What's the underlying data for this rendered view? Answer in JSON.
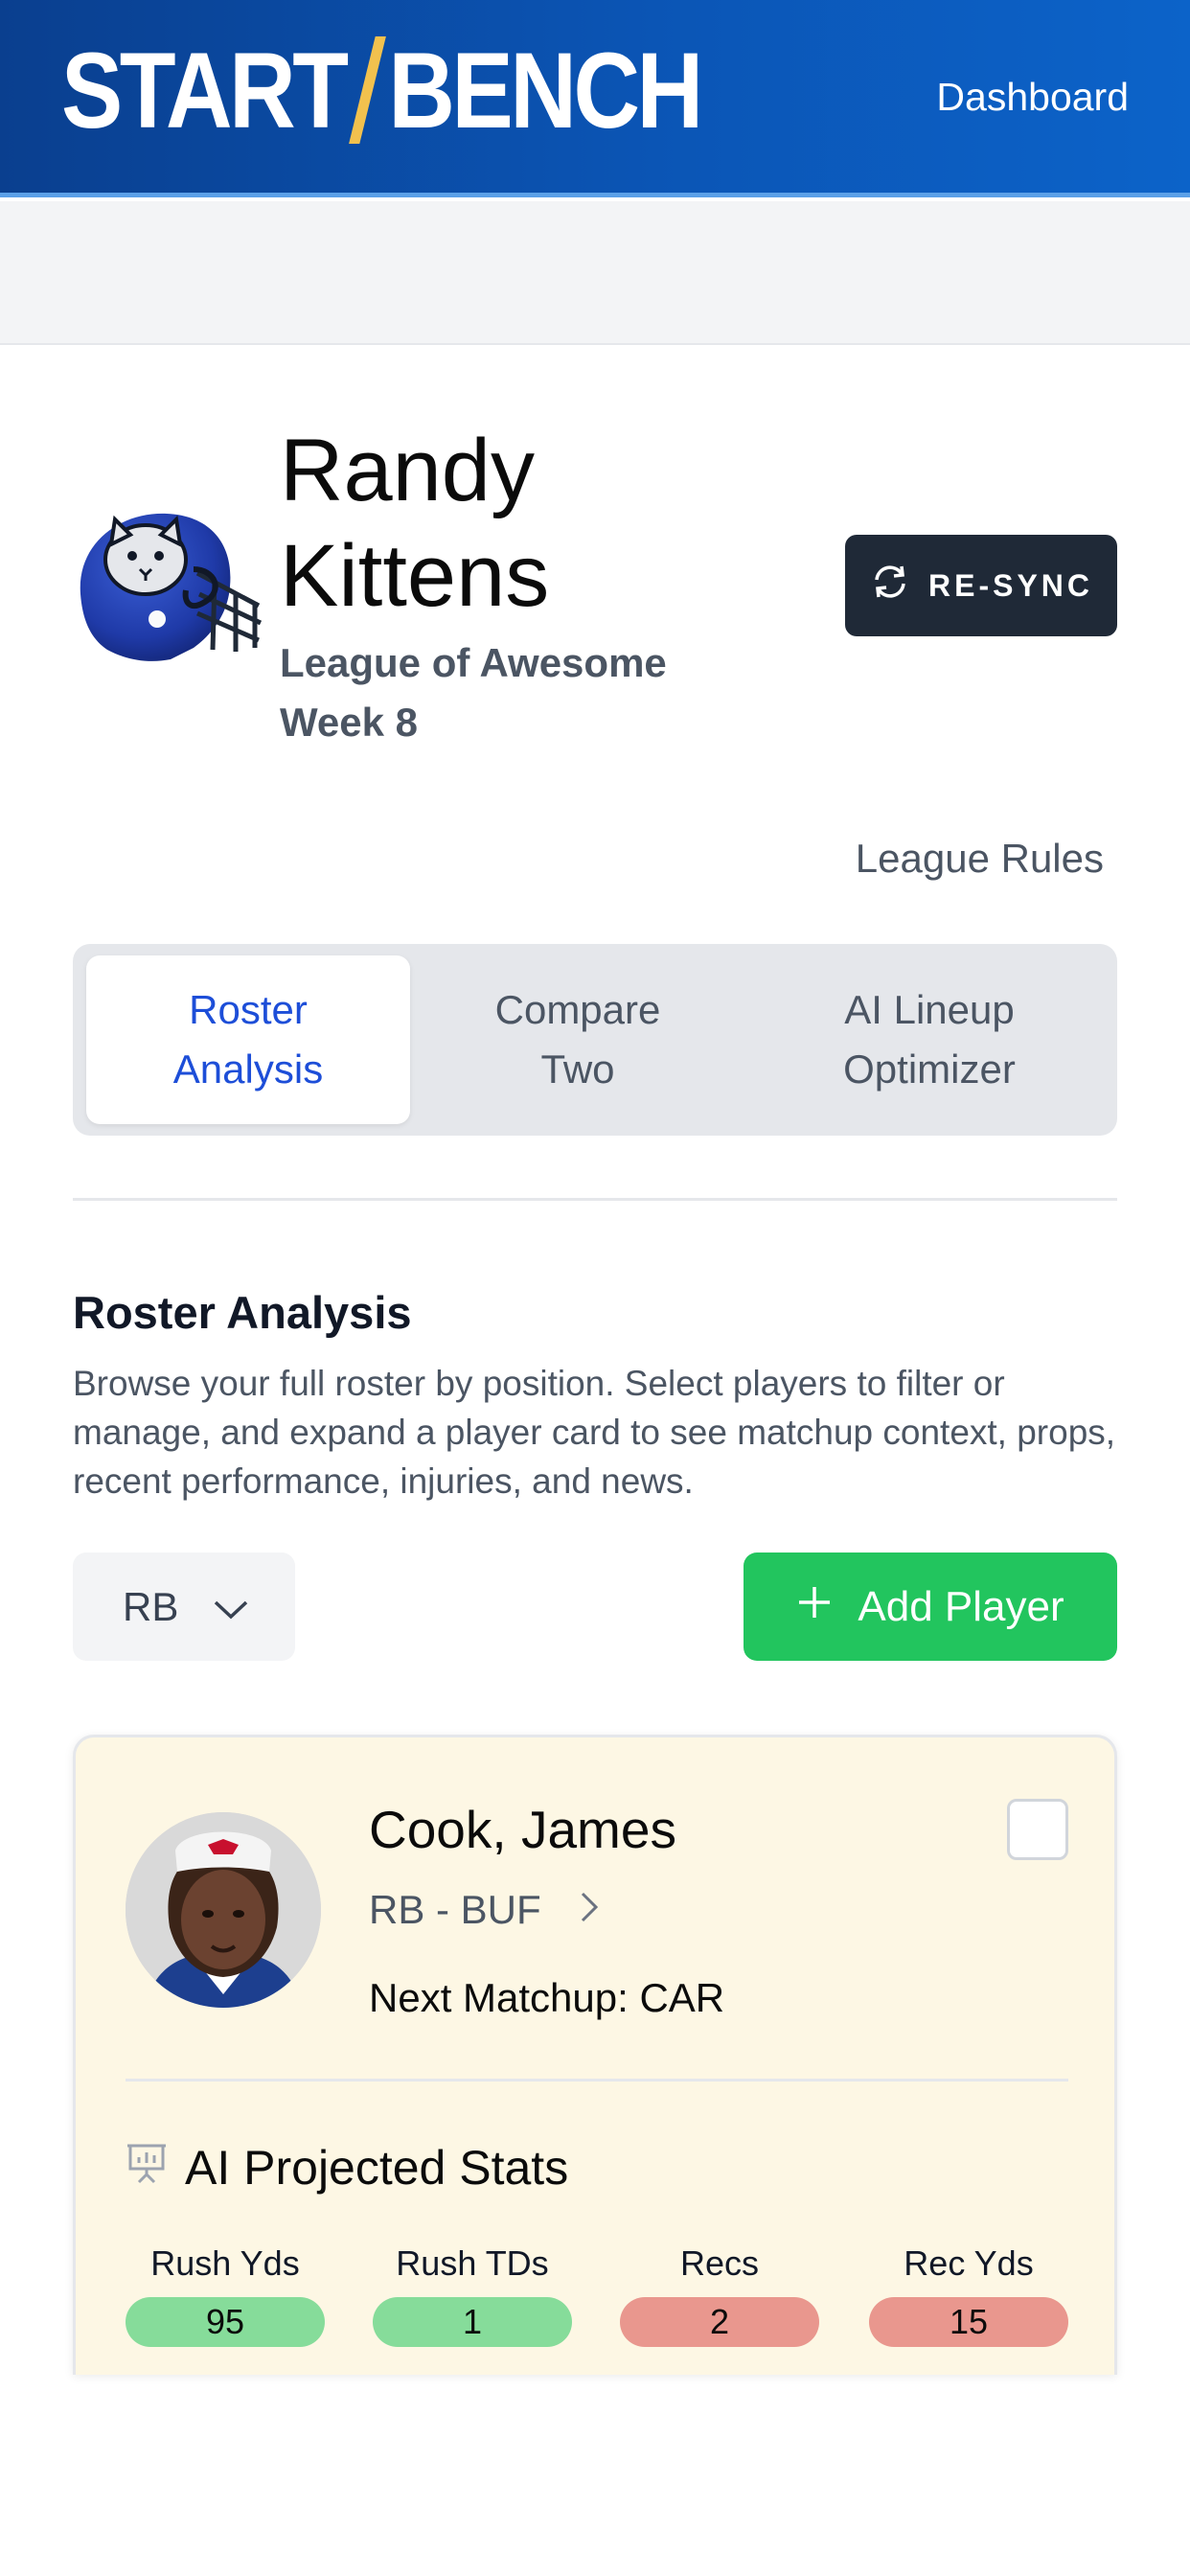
{
  "header": {
    "logo_left": "START",
    "logo_right": "BENCH",
    "nav_label": "Dashboard"
  },
  "team": {
    "name_line1": "Randy",
    "name_line2": "Kittens",
    "league": "League of Awesome",
    "week": "Week 8",
    "avatar_icon": "kitten-helmet-icon",
    "resync_label": "RE-SYNC"
  },
  "league_rules_label": "League Rules",
  "tabs": [
    {
      "line1": "Roster",
      "line2": "Analysis",
      "active": true
    },
    {
      "line1": "Compare",
      "line2": "Two",
      "active": false
    },
    {
      "line1": "AI Lineup",
      "line2": "Optimizer",
      "active": false
    }
  ],
  "roster": {
    "title": "Roster Analysis",
    "description": "Browse your full roster by position. Select players to filter or manage, and expand a player card to see matchup context, props, recent performance, injuries, and news.",
    "position_filter": "RB",
    "add_player_label": "Add Player"
  },
  "player": {
    "name": "Cook, James",
    "position_team": "RB - BUF",
    "next_matchup": "Next Matchup: CAR",
    "projected_title": "AI Projected Stats",
    "stats": [
      {
        "label": "Rush Yds",
        "value": "95",
        "status": "good"
      },
      {
        "label": "Rush TDs",
        "value": "1",
        "status": "good"
      },
      {
        "label": "Recs",
        "value": "2",
        "status": "bad"
      },
      {
        "label": "Rec Yds",
        "value": "15",
        "status": "bad"
      }
    ]
  },
  "colors": {
    "header_blue": "#0b55b5",
    "accent_gold": "#f2c14e",
    "active_tab": "#1d4ed8",
    "add_green": "#22c55e",
    "card_bg": "#fdf7e4",
    "stat_good": "#86dc9a",
    "stat_bad": "#e9978e"
  }
}
